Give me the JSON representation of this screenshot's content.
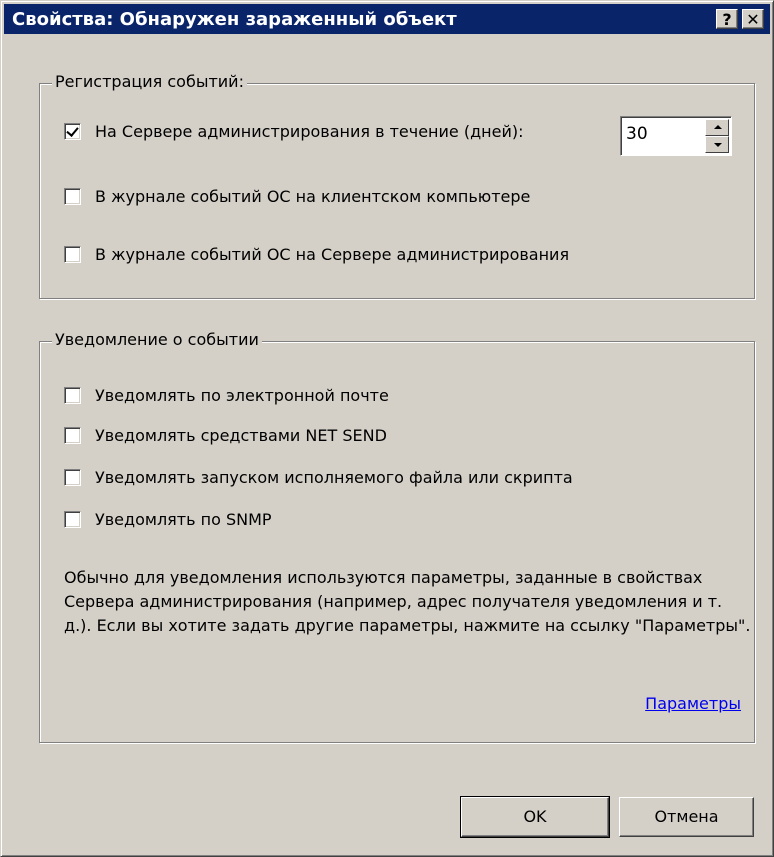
{
  "window": {
    "title": "Свойства: Обнаружен зараженный объект",
    "help_button": "?",
    "close_button": "✕"
  },
  "event_log": {
    "legend": "Регистрация событий:",
    "server_days": {
      "label": "На Сервере администрирования в течение (дней):",
      "checked": true,
      "value": "30"
    },
    "client_os_log": {
      "label": "В журнале событий ОС на клиентском компьютере",
      "checked": false
    },
    "server_os_log": {
      "label": "В журнале событий ОС на Сервере администрирования",
      "checked": false
    }
  },
  "notification": {
    "legend": "Уведомление о событии",
    "email": {
      "label": "Уведомлять по электронной почте",
      "checked": false
    },
    "net_send": {
      "label": "Уведомлять средствами NET SEND",
      "checked": false
    },
    "exec": {
      "label": "Уведомлять запуском исполняемого файла или скрипта",
      "checked": false
    },
    "snmp": {
      "label": "Уведомлять по SNMP",
      "checked": false
    },
    "note": "Обычно для уведомления используются параметры, заданные в свойствах Сервера администрирования (например, адрес получателя уведомления и т. д.). Если вы хотите задать другие параметры, нажмите на ссылку \"Параметры\".",
    "params_link": "Параметры"
  },
  "buttons": {
    "ok": "OK",
    "cancel": "Отмена"
  }
}
